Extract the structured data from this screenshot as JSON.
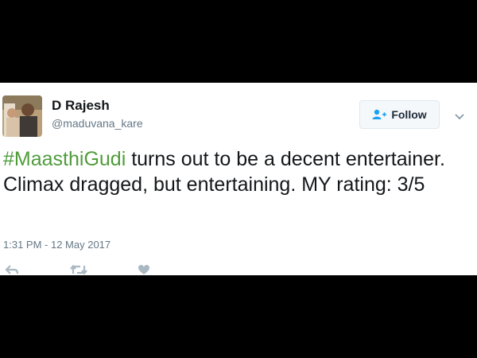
{
  "tweet": {
    "display_name": "D Rajesh",
    "handle": "@maduvana_kare",
    "follow_label": "Follow",
    "hashtag": "#MaasthiGudi",
    "body_text": " turns out to be a decent entertainer. Climax dragged, but entertaining. MY rating: 3/5",
    "timestamp": "1:31 PM - 12 May 2017",
    "icons": {
      "follow": "add-user-icon",
      "menu": "chevron-down-icon",
      "reply": "reply-icon",
      "retweet": "retweet-icon",
      "like": "heart-icon"
    }
  },
  "colors": {
    "hashtag": "#4f9c3b",
    "background": "#000000",
    "card": "#ffffff",
    "secondary_text": "#657786",
    "follow_icon": "#1da1f2"
  }
}
